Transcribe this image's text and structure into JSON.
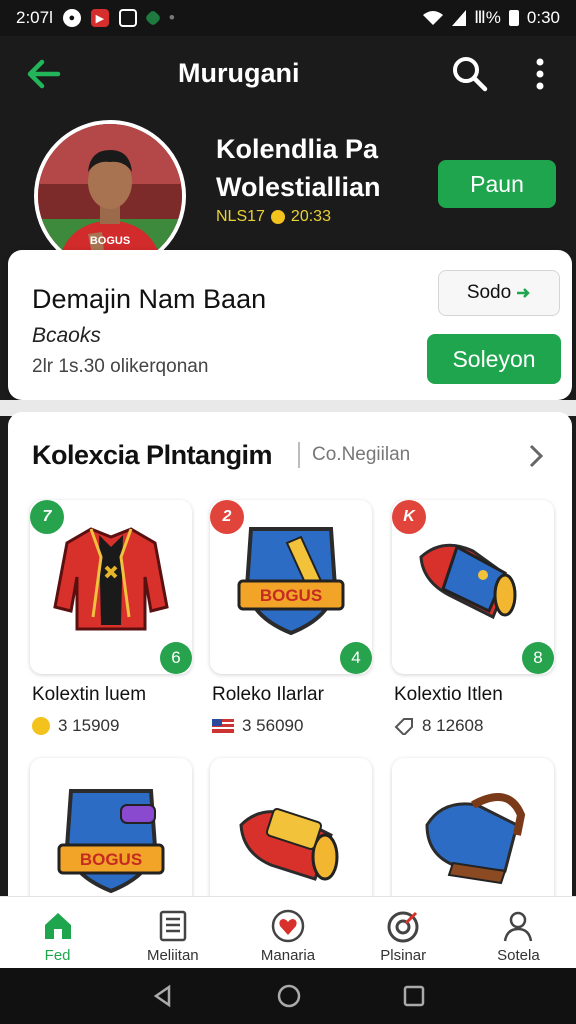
{
  "status_bar": {
    "time_left": "2:07l",
    "signal_text": "Ⅲ%",
    "time_right": "0:30"
  },
  "app_bar": {
    "title": "Murugani"
  },
  "profile": {
    "name": "Kolendlia Pa Wolestiallian",
    "stats_prefix": "NLS17",
    "stats_value": "20:33",
    "action_label": "Paun"
  },
  "summary_card": {
    "heading": "Demajin Nam Baan",
    "subheading": "Bcaoks",
    "detail": "2lr  1s.30 olikerqonan",
    "secondary_button": "Sodo",
    "primary_button": "Soleyon"
  },
  "collection": {
    "heading": "Kolexcia Plntangim",
    "subheading": "Co.Negiilan",
    "items": [
      {
        "rank": "7",
        "name": "Kolextin luem",
        "price": "3 15909",
        "count": "6",
        "rank_color": "#27a34e"
      },
      {
        "rank": "2",
        "name": "Roleko Ilarlar",
        "price": "3 56090",
        "count": "4",
        "rank_color": "#e0443a"
      },
      {
        "rank": "K",
        "name": "Kolextio Itlen",
        "price": "8 12608",
        "count": "8",
        "rank_color": "#e0443a"
      },
      {
        "rank": "",
        "name": "",
        "price": "",
        "count": ""
      },
      {
        "rank": "",
        "name": "",
        "price": "",
        "count": ""
      },
      {
        "rank": "",
        "name": "",
        "price": "",
        "count": ""
      }
    ]
  },
  "bottom_nav": [
    {
      "label": "Fed",
      "icon": "home-icon",
      "active": true
    },
    {
      "label": "Meliitan",
      "icon": "list-icon"
    },
    {
      "label": "Manaria",
      "icon": "heart-icon"
    },
    {
      "label": "Plsinar",
      "icon": "target-icon"
    },
    {
      "label": "Sotela",
      "icon": "profile-icon"
    }
  ],
  "colors": {
    "brand_green": "#1fa54e",
    "badge_red": "#e0443a",
    "gold": "#e9d236"
  }
}
